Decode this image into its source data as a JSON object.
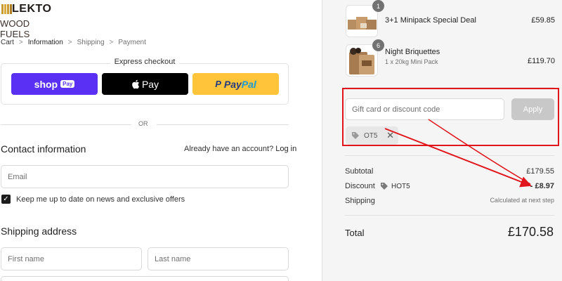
{
  "brand": {
    "logo_top": "LEKTO",
    "logo_bottom": "WOOD FUELS"
  },
  "breadcrumb": {
    "cart": "Cart",
    "information": "Information",
    "shipping": "Shipping",
    "payment": "Payment",
    "sep": ">"
  },
  "express": {
    "title": "Express checkout",
    "shoppay": {
      "word": "shop",
      "tag": "Pay"
    },
    "applepay": {
      "label": "Pay"
    },
    "paypal": {
      "p1": "Pay",
      "p2": "Pal"
    }
  },
  "or_text": "OR",
  "contact": {
    "heading": "Contact information",
    "account_prompt": "Already have an account?",
    "login_label": "Log in",
    "email_placeholder": "Email",
    "newsletter_label": "Keep me up to date on news and exclusive offers"
  },
  "shipping_address": {
    "heading": "Shipping address",
    "first_name_placeholder": "First name",
    "last_name_placeholder": "Last name"
  },
  "cart": {
    "items": [
      {
        "qty": "1",
        "name": "3+1 Minipack Special Deal",
        "variant": "",
        "price": "£59.85"
      },
      {
        "qty": "6",
        "name": "Night Briquettes",
        "variant": "1 x 20kg Mini Pack",
        "price": "£119.70"
      }
    ],
    "discount_placeholder": "Gift card or discount code",
    "apply_label": "Apply",
    "applied_code": "HOT5",
    "chip_code_visible": "OT5"
  },
  "summary": {
    "subtotal_label": "Subtotal",
    "subtotal_value": "£179.55",
    "discount_label": "Discount",
    "discount_code": "HOT5",
    "discount_value": "- £8.97",
    "shipping_label": "Shipping",
    "shipping_value": "Calculated at next step",
    "total_label": "Total",
    "total_value": "£170.58"
  },
  "colors": {
    "annotation": "#e0161c",
    "shoppay": "#5a31f4",
    "paypal": "#ffc439"
  }
}
